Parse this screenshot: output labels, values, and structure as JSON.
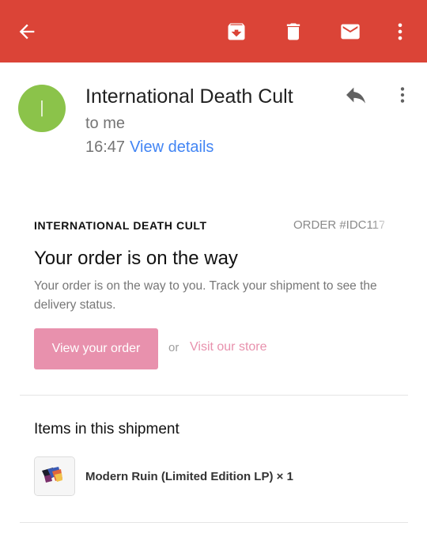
{
  "toolbar": {
    "back_icon": "arrow-left-icon",
    "archive_icon": "archive-icon",
    "delete_icon": "trash-icon",
    "mark_unread_icon": "mail-icon",
    "more_icon": "more-vertical-icon",
    "color": "#db4437"
  },
  "message": {
    "avatar_letter": "I",
    "avatar_color": "#8bc34a",
    "sender": "International Death Cult",
    "recipient": "to me",
    "time": "16:47",
    "details_link": "View details",
    "reply_icon": "reply-icon",
    "more_icon": "more-vertical-icon"
  },
  "email": {
    "shop_name": "INTERNATIONAL DEATH CULT",
    "order_number": "ORDER #IDC117",
    "heading": "Your order is on the way",
    "body": "Your order is on the way to you. Track your shipment to see the delivery status.",
    "cta_label": "View your order",
    "or_text": "or",
    "store_link": "Visit our store",
    "accent_color": "#e891ad",
    "items_heading": "Items in this shipment",
    "items": [
      {
        "name": "Modern Ruin (Limited Edition LP) × 1"
      }
    ]
  }
}
